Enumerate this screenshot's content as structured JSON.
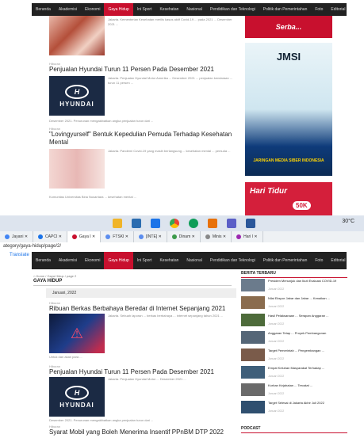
{
  "top_nav": {
    "items": [
      "Beranda",
      "Akademisi",
      "Ekonomi",
      "Gaya Hidup",
      "Ini Sport",
      "Kesehatan",
      "Nasional",
      "Pendidikan dan Teknologi",
      "Politik dan Pemerintahan",
      "Foto",
      "Editorial"
    ],
    "active_index": 3,
    "close_glyph": "⤨"
  },
  "page1": {
    "article0": {
      "snippet": "Jakarta. Kementerian Kesehatan merilis kasus aktif Covid-19 ... pada 2021 ... Desember 2021 ..."
    },
    "article1": {
      "meta": "Hiburan",
      "title": "Penjualan Hyundai Turun 11 Persen Pada Desember 2021",
      "thumb_word": "HYUNDAI",
      "thumb_logo": "H",
      "snippet": "Jakarta. Penjualan Hyundai Motor Amerika ... Desember 2021 ... penjualan kendaraan ... turun 11 persen ...",
      "foot": "Desember 2021. Penurunan mengakibatkan angka penjualan turun dari ..."
    },
    "article2": {
      "meta": "Hiburan",
      "title": "\"Lovingyurself\" Bentuk Kepedulian Pemuda Terhadap Kesehatan Mental",
      "snippet": "Jakarta. Pandemi Covid-19 yang masih berlangsung ... kesehatan mental ... pemuda ...",
      "foot": "Komunitas Universitas Bina Nusantara ... kesehatan mental ..."
    }
  },
  "sidebar1": {
    "ad1_text": "Serba...",
    "jmsi_title": "JMSI",
    "jmsi_caption": "JARINGAN MEDIA SIBER INDONESIA",
    "ad3_text": "Hari Tidur",
    "ad3_pct": "50K"
  },
  "taskbar": {
    "temperature": "30°C",
    "icons": [
      "file-explorer-icon",
      "store-icon",
      "mail-icon",
      "chrome-icon",
      "edge-icon",
      "photos-icon",
      "teams-icon",
      "word-icon"
    ]
  },
  "tabs": [
    {
      "label": "Jayani",
      "color": "#4285f4"
    },
    {
      "label": "CAPCI",
      "color": "#1a73e8"
    },
    {
      "label": "Gaya I",
      "color": "#c8102e",
      "active": true
    },
    {
      "label": "FTSKI",
      "color": "#5b8def"
    },
    {
      "label": "[INTE]",
      "color": "#5b8def"
    },
    {
      "label": "Dinam",
      "color": "#3c9a4a"
    },
    {
      "label": "Minis",
      "color": "#888888"
    },
    {
      "label": "Hari I",
      "color": "#9c27b0"
    }
  ],
  "address_bar": "ategory/gaya-hidup/page/2/",
  "translate_label": "Translate",
  "page2": {
    "breadcrumb": "⌂ Home / Gaya Hidup / page 2",
    "section_title": "GAYA HIDUP",
    "month": "Januari, 2022",
    "articles": [
      {
        "meta": "Hiburan",
        "title": "Ribuan Berkas Berbahaya Beredar di Internet Sepanjang 2021",
        "snippet": "Jakarta. Sebuah laporan ... berkas berbahaya ... internet sepanjang tahun 2021 ...",
        "foot": "Untuk dan akan para ..."
      },
      {
        "meta": "Hiburan",
        "title": "Penjualan Hyundai Turun 11 Persen Pada Desember 2021",
        "snippet": "Jakarta. Penjualan Hyundai Motor ... Desember 2021 ...",
        "foot": "Desember 2021. Penurunan mengakibatkan angka penjualan turun dari ..."
      },
      {
        "meta": "Hiburan",
        "title": "Syarat Mobil yang Boleh Menerima Insentif PPnBM DTP 2022"
      }
    ]
  },
  "sidebar2": {
    "heading": "BERITA TERBARU",
    "items": [
      {
        "title": "Presiden Menunjuk dan Ikuti Evaluasi COVID-19",
        "date": "Januari 2022",
        "color": "#6b7b8c"
      },
      {
        "title": "Nilai Ekspor Jabar dan Jabar ... Kenaikan ...",
        "date": "Januari 2022",
        "color": "#8a6c4e"
      },
      {
        "title": "Hasil Pelaksanaan ... Serapan Anggaran ...",
        "date": "Januari 2022",
        "color": "#4d6b3a"
      },
      {
        "title": "Anggaran Tetap ... Proyek Pembangunan",
        "date": "Januari 2022",
        "color": "#556677"
      },
      {
        "title": "Target Pemerintah ... Pengembangan ...",
        "date": "Januari 2022",
        "color": "#7a5b4a"
      },
      {
        "title": "Empat Keluhan Masyarakat Terhadap ...",
        "date": "Januari 2022",
        "color": "#3f5f7a"
      },
      {
        "title": "Korban Kejahatan ... Tercatat ...",
        "date": "Januari 2022",
        "color": "#6a6a6a"
      },
      {
        "title": "Target Selesai di Jakarta Akhir Juli 2022",
        "date": "Januari 2022",
        "color": "#2f4f6f"
      }
    ],
    "footer_heading": "PODCAST"
  },
  "colors": {
    "accent": "#c8102e",
    "nav_bg": "#222222",
    "taskbar_bg": "#dde4ee"
  }
}
